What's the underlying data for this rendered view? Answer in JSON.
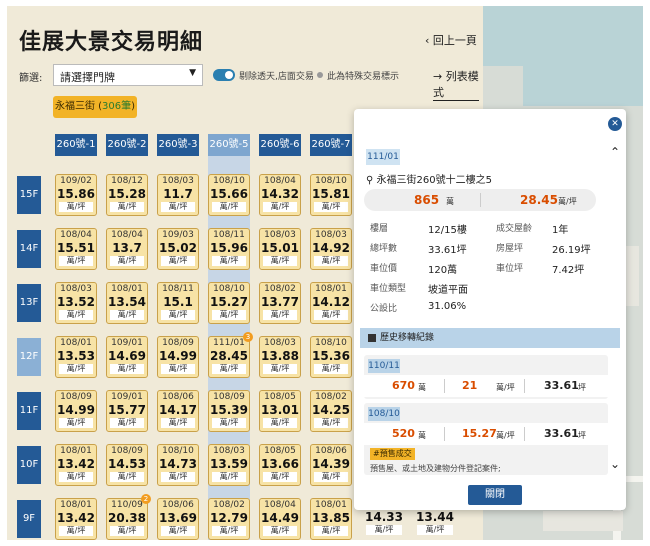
{
  "page": {
    "title": "佳展大景交易明細",
    "back_label": "‹ 回上一頁",
    "filter_label": "篩選:",
    "select_value": "請選擇門牌",
    "option_weekend": "剔除透天,店面交易",
    "option_special": "此為特殊交易標示",
    "list_mode": "→ 列表模式",
    "street_prefix": "永福三街 (",
    "street_count": "306筆",
    "street_suffix": ")"
  },
  "colors": {
    "accent": "#245a96",
    "cell": "#f7e3a6",
    "badge": "#f2b327",
    "price": "#d94d00"
  },
  "columns": [
    "260號-1",
    "260號-2",
    "260號-3",
    "260號-5",
    "260號-6",
    "260號-7"
  ],
  "floors": [
    {
      "label": "15F",
      "cells": [
        {
          "d": "109/02",
          "p": "15.86",
          "u": "萬/坪"
        },
        {
          "d": "108/12",
          "p": "15.28",
          "u": "萬/坪"
        },
        {
          "d": "108/03",
          "p": "11.7",
          "u": "萬/坪"
        },
        {
          "d": "108/10",
          "p": "15.66",
          "u": "萬/坪"
        },
        {
          "d": "108/04",
          "p": "14.32",
          "u": "萬/坪"
        },
        {
          "d": "108/10",
          "p": "15.81",
          "u": "萬/坪"
        }
      ]
    },
    {
      "label": "14F",
      "cells": [
        {
          "d": "108/04",
          "p": "15.51",
          "u": "萬/坪"
        },
        {
          "d": "108/04",
          "p": "13.7",
          "u": "萬/坪"
        },
        {
          "d": "109/03",
          "p": "15.02",
          "u": "萬/坪"
        },
        {
          "d": "108/11",
          "p": "15.96",
          "u": "萬/坪"
        },
        {
          "d": "108/03",
          "p": "15.01",
          "u": "萬/坪"
        },
        {
          "d": "108/03",
          "p": "14.92",
          "u": "萬/坪"
        }
      ]
    },
    {
      "label": "13F",
      "cells": [
        {
          "d": "108/03",
          "p": "13.52",
          "u": "萬/坪"
        },
        {
          "d": "108/01",
          "p": "13.54",
          "u": "萬/坪"
        },
        {
          "d": "108/11",
          "p": "15.1",
          "u": "萬/坪"
        },
        {
          "d": "108/10",
          "p": "15.27",
          "u": "萬/坪"
        },
        {
          "d": "108/02",
          "p": "13.77",
          "u": "萬/坪"
        },
        {
          "d": "108/01",
          "p": "14.12",
          "u": "萬/坪"
        }
      ]
    },
    {
      "label": "12F",
      "cells": [
        {
          "d": "108/01",
          "p": "13.53",
          "u": "萬/坪"
        },
        {
          "d": "109/01",
          "p": "14.69",
          "u": "萬/坪"
        },
        {
          "d": "108/09",
          "p": "14.99",
          "u": "萬/坪"
        },
        {
          "d": "111/01",
          "p": "28.45",
          "u": "萬/坪",
          "badge": "3"
        },
        {
          "d": "108/03",
          "p": "13.88",
          "u": "萬/坪"
        },
        {
          "d": "108/10",
          "p": "15.36",
          "u": "萬/坪"
        }
      ]
    },
    {
      "label": "11F",
      "cells": [
        {
          "d": "108/09",
          "p": "14.99",
          "u": "萬/坪"
        },
        {
          "d": "109/01",
          "p": "15.77",
          "u": "萬/坪"
        },
        {
          "d": "108/06",
          "p": "14.17",
          "u": "萬/坪"
        },
        {
          "d": "108/09",
          "p": "15.39",
          "u": "萬/坪"
        },
        {
          "d": "108/05",
          "p": "13.01",
          "u": "萬/坪"
        },
        {
          "d": "108/02",
          "p": "14.25",
          "u": "萬/坪"
        }
      ]
    },
    {
      "label": "10F",
      "cells": [
        {
          "d": "108/01",
          "p": "13.42",
          "u": "萬/坪"
        },
        {
          "d": "108/09",
          "p": "14.53",
          "u": "萬/坪"
        },
        {
          "d": "108/10",
          "p": "14.73",
          "u": "萬/坪"
        },
        {
          "d": "108/03",
          "p": "13.59",
          "u": "萬/坪"
        },
        {
          "d": "108/05",
          "p": "13.66",
          "u": "萬/坪"
        },
        {
          "d": "108/06",
          "p": "14.39",
          "u": "萬/坪"
        }
      ]
    },
    {
      "label": "9F",
      "cells": [
        {
          "d": "108/01",
          "p": "13.42",
          "u": "萬/坪"
        },
        {
          "d": "110/09",
          "p": "20.38",
          "u": "萬/坪",
          "badge": "2"
        },
        {
          "d": "108/06",
          "p": "13.69",
          "u": "萬/坪"
        },
        {
          "d": "108/02",
          "p": "12.79",
          "u": "萬/坪"
        },
        {
          "d": "108/04",
          "p": "14.49",
          "u": "萬/坪"
        },
        {
          "d": "108/01",
          "p": "13.85",
          "u": "萬/坪"
        }
      ]
    }
  ],
  "extra_cells": [
    {
      "p": "14.33",
      "u": "萬/坪"
    },
    {
      "p": "13.44",
      "u": "萬/坪"
    }
  ],
  "modal": {
    "date": "111/01",
    "address": "永福三街260號十二樓之5",
    "total_price": "865",
    "total_unit": "萬",
    "unit_price": "28.45",
    "unit_price_unit": "萬/坪",
    "info": [
      {
        "k": "樓層",
        "v": "12/15樓",
        "k2": "成交屋齡",
        "v2": "1年"
      },
      {
        "k": "總坪數",
        "v": "33.61坪",
        "k2": "房屋坪",
        "v2": "26.19坪"
      },
      {
        "k": "車位價",
        "v": "120萬",
        "k2": "車位坪",
        "v2": "7.42坪"
      },
      {
        "k": "車位類型",
        "v": "坡道平面",
        "k2": "",
        "v2": ""
      },
      {
        "k": "公設比",
        "v": "31.06%",
        "k2": "",
        "v2": ""
      }
    ],
    "history_title": "歷史移轉紀錄",
    "history": [
      {
        "date": "110/11",
        "total": "670",
        "total_unit": "萬",
        "unit": "21",
        "unit_label": "萬/坪",
        "area": "33.61",
        "area_unit": "坪"
      },
      {
        "date": "108/10",
        "total": "520",
        "total_unit": "萬",
        "unit": "15.27",
        "unit_label": "萬/坪",
        "area": "33.61",
        "area_unit": "坪",
        "tag": "#預售成交",
        "note": "預售屋、或土地及建物分件登記案件;"
      }
    ],
    "close_label": "關閉",
    "close_icon": "✕"
  }
}
